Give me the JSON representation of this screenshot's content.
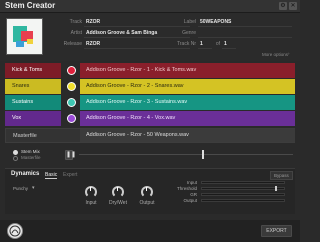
{
  "window": {
    "title": "Stem Creator"
  },
  "metadata": {
    "track_label": "Track",
    "track": "RZOR",
    "artist_label": "Artist",
    "artist": "Addison Groove & Sam Binga",
    "release_label": "Release",
    "release": "RZOR",
    "label_label": "Label",
    "label": "50WEAPONS",
    "genre_label": "Genre",
    "genre": "",
    "track_no_label": "Track Nr",
    "track_no": "1",
    "track_of_label": "of",
    "track_of": "1",
    "more_options": "More options"
  },
  "stems": [
    {
      "name": "Kick & Toms",
      "file": "Addison Groove - Rzor - 1 - Kick & Toms.wav",
      "color": "#e0213d",
      "file_bg": "#8a1f2b",
      "name_bg": "#7d1c27",
      "text_color": "#f2c9cd"
    },
    {
      "name": "Snares",
      "file": "Addison Groove - Rzor - 2 - Snares.wav",
      "color": "#f2e02e",
      "file_bg": "#d4c324",
      "name_bg": "#cbbb22",
      "text_color": "#2a2a10"
    },
    {
      "name": "Sustains",
      "file": "Addison Groove - Rzor - 3 - Sustains.wav",
      "color": "#3ec8b3",
      "file_bg": "#169583",
      "name_bg": "#128a79",
      "text_color": "#e4fbf7"
    },
    {
      "name": "Vox",
      "file": "Addison Groove - Rzor - 4 - Vox.wav",
      "color": "#9a4bd6",
      "file_bg": "#6a2f98",
      "name_bg": "#62298d",
      "text_color": "#efe1fb"
    }
  ],
  "master": {
    "name": "Masterfile",
    "file": "Addison Groove - Rzor - 50 Weapons.wav"
  },
  "transport": {
    "stem_mix_label": "Stem Mix",
    "masterfile_label": "Masterfile"
  },
  "dynamics": {
    "title": "Dynamics",
    "tabs": [
      "Basic",
      "Expert"
    ],
    "punchy_label": "Punchy",
    "bypass_label": "Bypass",
    "knobs": [
      "Input",
      "Dry/Wet",
      "Output"
    ],
    "meters": [
      "Input",
      "Threshold",
      "GR",
      "Output"
    ]
  },
  "footer": {
    "export_label": "EXPORT"
  }
}
